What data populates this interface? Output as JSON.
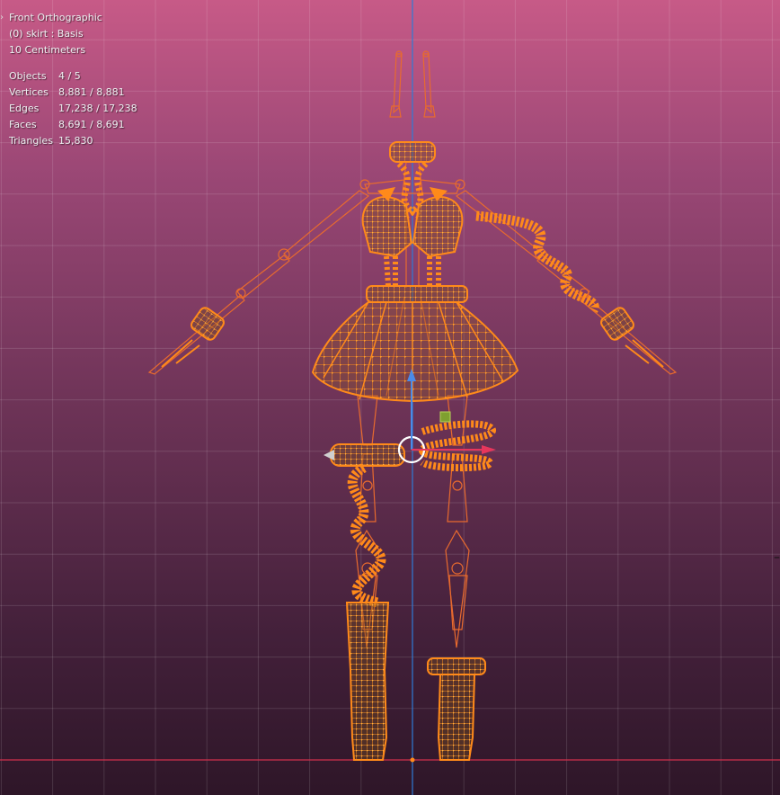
{
  "viewport": {
    "view_name": "Front Orthographic",
    "object_info": "(0) skirt : Basis",
    "grid_scale": "10 Centimeters"
  },
  "statistics": [
    {
      "label": "Objects",
      "value": "4 / 5"
    },
    {
      "label": "Vertices",
      "value": "8,881 / 8,881"
    },
    {
      "label": "Edges",
      "value": "17,238 / 17,238"
    },
    {
      "label": "Faces",
      "value": "8,691 / 8,691"
    },
    {
      "label": "Triangles",
      "value": "15,830"
    }
  ],
  "colors": {
    "wire": "#ff8a1a",
    "bone": "#e86a2e",
    "z_axis": "#2f7bd6",
    "x_axis": "#d0304c",
    "gizmo_x": "#e6365c",
    "gizmo_z": "#4a8be8",
    "gizmo_center": "#7fa02f"
  },
  "icons": [
    "expand-arrow-icon",
    "3d-cursor-icon",
    "transform-gizmo-icon"
  ]
}
